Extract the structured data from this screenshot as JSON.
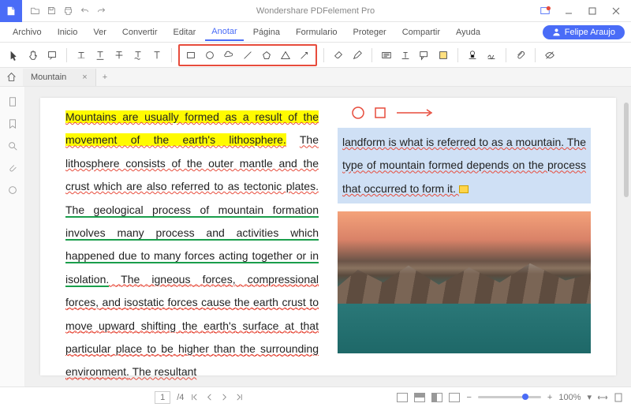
{
  "app": {
    "title": "Wondershare PDFelement Pro"
  },
  "menu": {
    "items": [
      "Archivo",
      "Inicio",
      "Ver",
      "Convertir",
      "Editar",
      "Anotar",
      "Página",
      "Formulario",
      "Proteger",
      "Compartir",
      "Ayuda"
    ],
    "active": "Anotar"
  },
  "user": {
    "name": "Felipe Araujo"
  },
  "tab": {
    "name": "Mountain"
  },
  "doc": {
    "col1_highlight": "Mountains are usually formed as a result of the movement of the earth's lithosphere.",
    "col1_strike": "The lithosphere consists of the outer mantle and the crust which are also referred to as tectonic plates.",
    "col1_green": " The geological process of mountain formation involves many process and activities which happened due to many forces acting together or in isolation.",
    "col1_red": " The igneous forces, compressional forces, and isostatic forces cause the earth crust to move upward shifting the earth's surface at that particular place to be higher than the surrounding environment.",
    "col1_tail": " The resultant",
    "col2_box": "landform is what is referred to as a mountain. The type of mountain formed depends on the process that occurred to form it. "
  },
  "status": {
    "page_current": "1",
    "page_total": "/4",
    "zoom": "100%"
  }
}
